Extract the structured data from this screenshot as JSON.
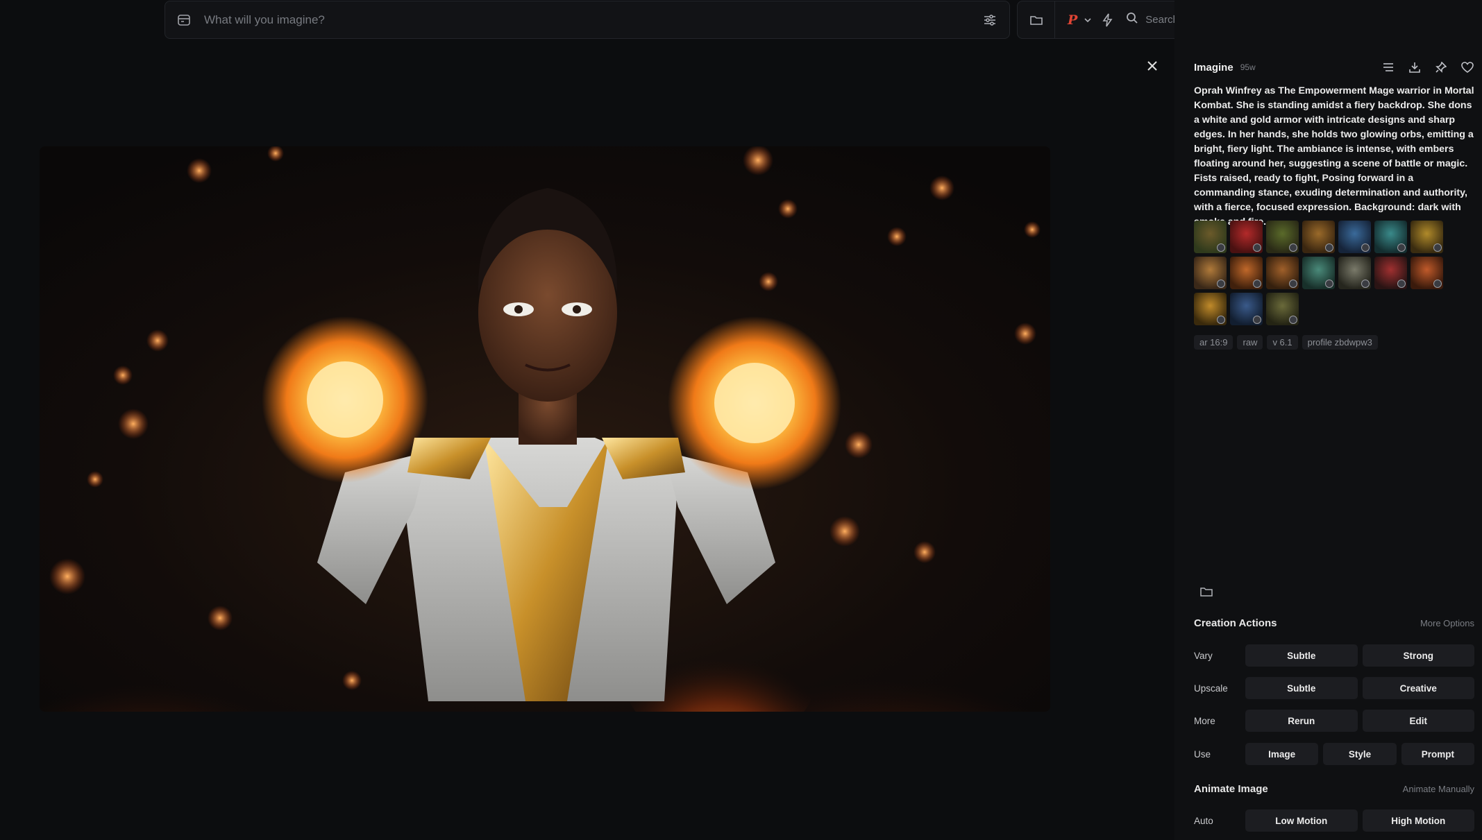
{
  "search": {
    "placeholder": "What will you imagine?"
  },
  "toolbar": {
    "profile_letter": "P",
    "search_prompts_label": "Search Prompts"
  },
  "panel": {
    "title": "Imagine",
    "age": "95w",
    "prompt": "Oprah Winfrey as The Empowerment Mage warrior in Mortal Kombat. She is standing amidst a fiery backdrop. She dons a white and gold armor with intricate designs and sharp edges. In her hands, she holds two glowing orbs, emitting a bright, fiery light. The ambiance is intense, with embers floating around her, suggesting a scene of battle or magic. Fists raised, ready to fight, Posing forward in a commanding stance, exuding determination and authority, with a fierce, focused expression. Background: dark with smoke and fire.",
    "reference_images": [
      {
        "color_a": "#6b5a2a",
        "color_b": "#2f3a1c"
      },
      {
        "color_a": "#b32a2a",
        "color_b": "#4a1111"
      },
      {
        "color_a": "#5a6a2a",
        "color_b": "#2a2a16"
      },
      {
        "color_a": "#9a6a2a",
        "color_b": "#3a2610"
      },
      {
        "color_a": "#3a6a9a",
        "color_b": "#16243a"
      },
      {
        "color_a": "#3a8a8a",
        "color_b": "#142e30"
      },
      {
        "color_a": "#b08a2a",
        "color_b": "#3a2c10"
      },
      {
        "color_a": "#b07a3a",
        "color_b": "#3a2818"
      },
      {
        "color_a": "#c0682a",
        "color_b": "#40200c"
      },
      {
        "color_a": "#a0602a",
        "color_b": "#35200e"
      },
      {
        "color_a": "#4a8a7a",
        "color_b": "#18302a"
      },
      {
        "color_a": "#7a7a6a",
        "color_b": "#26261e"
      },
      {
        "color_a": "#a03030",
        "color_b": "#2a1414"
      },
      {
        "color_a": "#c05a2a",
        "color_b": "#3a1a0c"
      },
      {
        "color_a": "#c08a2a",
        "color_b": "#3a2a0c"
      },
      {
        "color_a": "#3a5a8a",
        "color_b": "#121e30"
      },
      {
        "color_a": "#6a6a3a",
        "color_b": "#242414"
      }
    ],
    "params": [
      "ar 16:9",
      "raw",
      "v 6.1",
      "profile zbdwpw3"
    ]
  },
  "creation_actions": {
    "title": "Creation Actions",
    "more_options": "More Options",
    "rows": [
      {
        "label": "Vary",
        "buttons": [
          "Subtle",
          "Strong"
        ]
      },
      {
        "label": "Upscale",
        "buttons": [
          "Subtle",
          "Creative"
        ]
      },
      {
        "label": "More",
        "buttons": [
          "Rerun",
          "Edit"
        ]
      },
      {
        "label": "Use",
        "buttons": [
          "Image",
          "Style",
          "Prompt"
        ]
      }
    ]
  },
  "animate": {
    "title": "Animate Image",
    "manual_link": "Animate Manually",
    "row": {
      "label": "Auto",
      "buttons": [
        "Low Motion",
        "High Motion"
      ]
    }
  },
  "colors": {
    "accent_logo": "#e04434",
    "background": "#0c0d0f",
    "panel": "#0f1012",
    "button": "#1c1d21"
  }
}
